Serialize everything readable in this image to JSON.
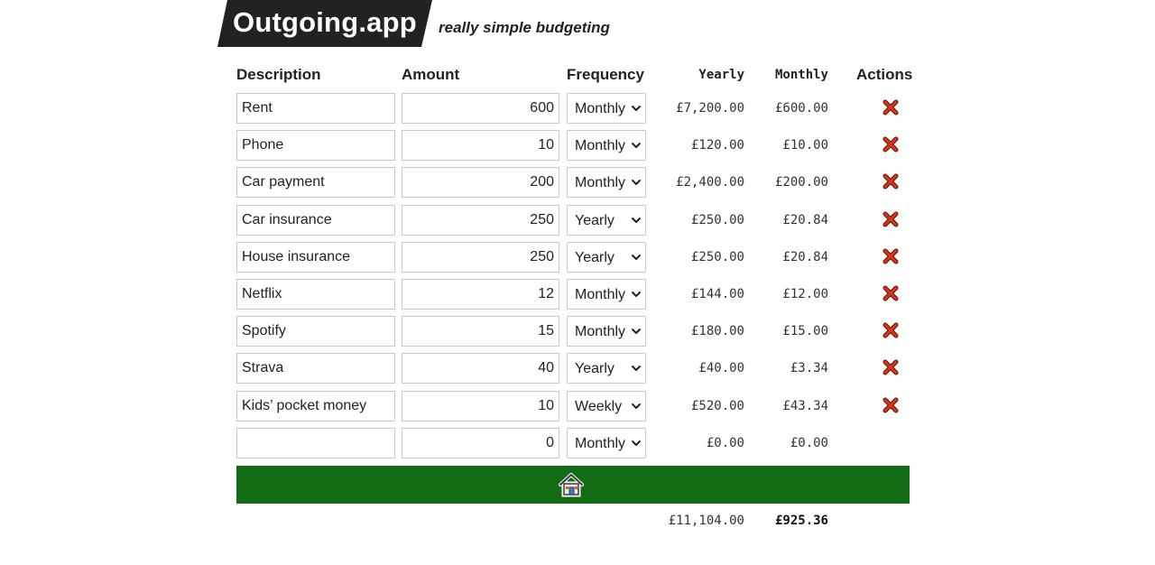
{
  "header": {
    "logo_text": "Outgoing.app",
    "tagline": "really simple budgeting"
  },
  "columns": {
    "description": "Description",
    "amount": "Amount",
    "frequency": "Frequency",
    "yearly": "Yearly",
    "monthly": "Monthly",
    "actions": "Actions"
  },
  "rows": [
    {
      "description": "Rent",
      "amount": "600",
      "frequency": "Monthly",
      "yearly": "£7,200.00",
      "monthly": "£600.00"
    },
    {
      "description": "Phone",
      "amount": "10",
      "frequency": "Monthly",
      "yearly": "£120.00",
      "monthly": "£10.00"
    },
    {
      "description": "Car payment",
      "amount": "200",
      "frequency": "Monthly",
      "yearly": "£2,400.00",
      "monthly": "£200.00"
    },
    {
      "description": "Car insurance",
      "amount": "250",
      "frequency": "Yearly",
      "yearly": "£250.00",
      "monthly": "£20.84"
    },
    {
      "description": "House insurance",
      "amount": "250",
      "frequency": "Yearly",
      "yearly": "£250.00",
      "monthly": "£20.84"
    },
    {
      "description": "Netflix",
      "amount": "12",
      "frequency": "Monthly",
      "yearly": "£144.00",
      "monthly": "£12.00"
    },
    {
      "description": "Spotify",
      "amount": "15",
      "frequency": "Monthly",
      "yearly": "£180.00",
      "monthly": "£15.00"
    },
    {
      "description": "Strava",
      "amount": "40",
      "frequency": "Yearly",
      "yearly": "£40.00",
      "monthly": "£3.34"
    },
    {
      "description": "Kids’ pocket money",
      "amount": "10",
      "frequency": "Weekly",
      "yearly": "£520.00",
      "monthly": "£43.34"
    }
  ],
  "new_row": {
    "description": "",
    "amount": "0",
    "frequency": "Monthly",
    "yearly": "£0.00",
    "monthly": "£0.00"
  },
  "totals": {
    "yearly": "£11,104.00",
    "monthly": "£925.36"
  },
  "icons": {
    "delete": "red-cross-icon",
    "home": "house-icon",
    "dropdown": "chevron-down-icon"
  },
  "colors": {
    "home_bar": "#136b13",
    "logo_bg": "#222222",
    "delete": "#d9361b"
  }
}
